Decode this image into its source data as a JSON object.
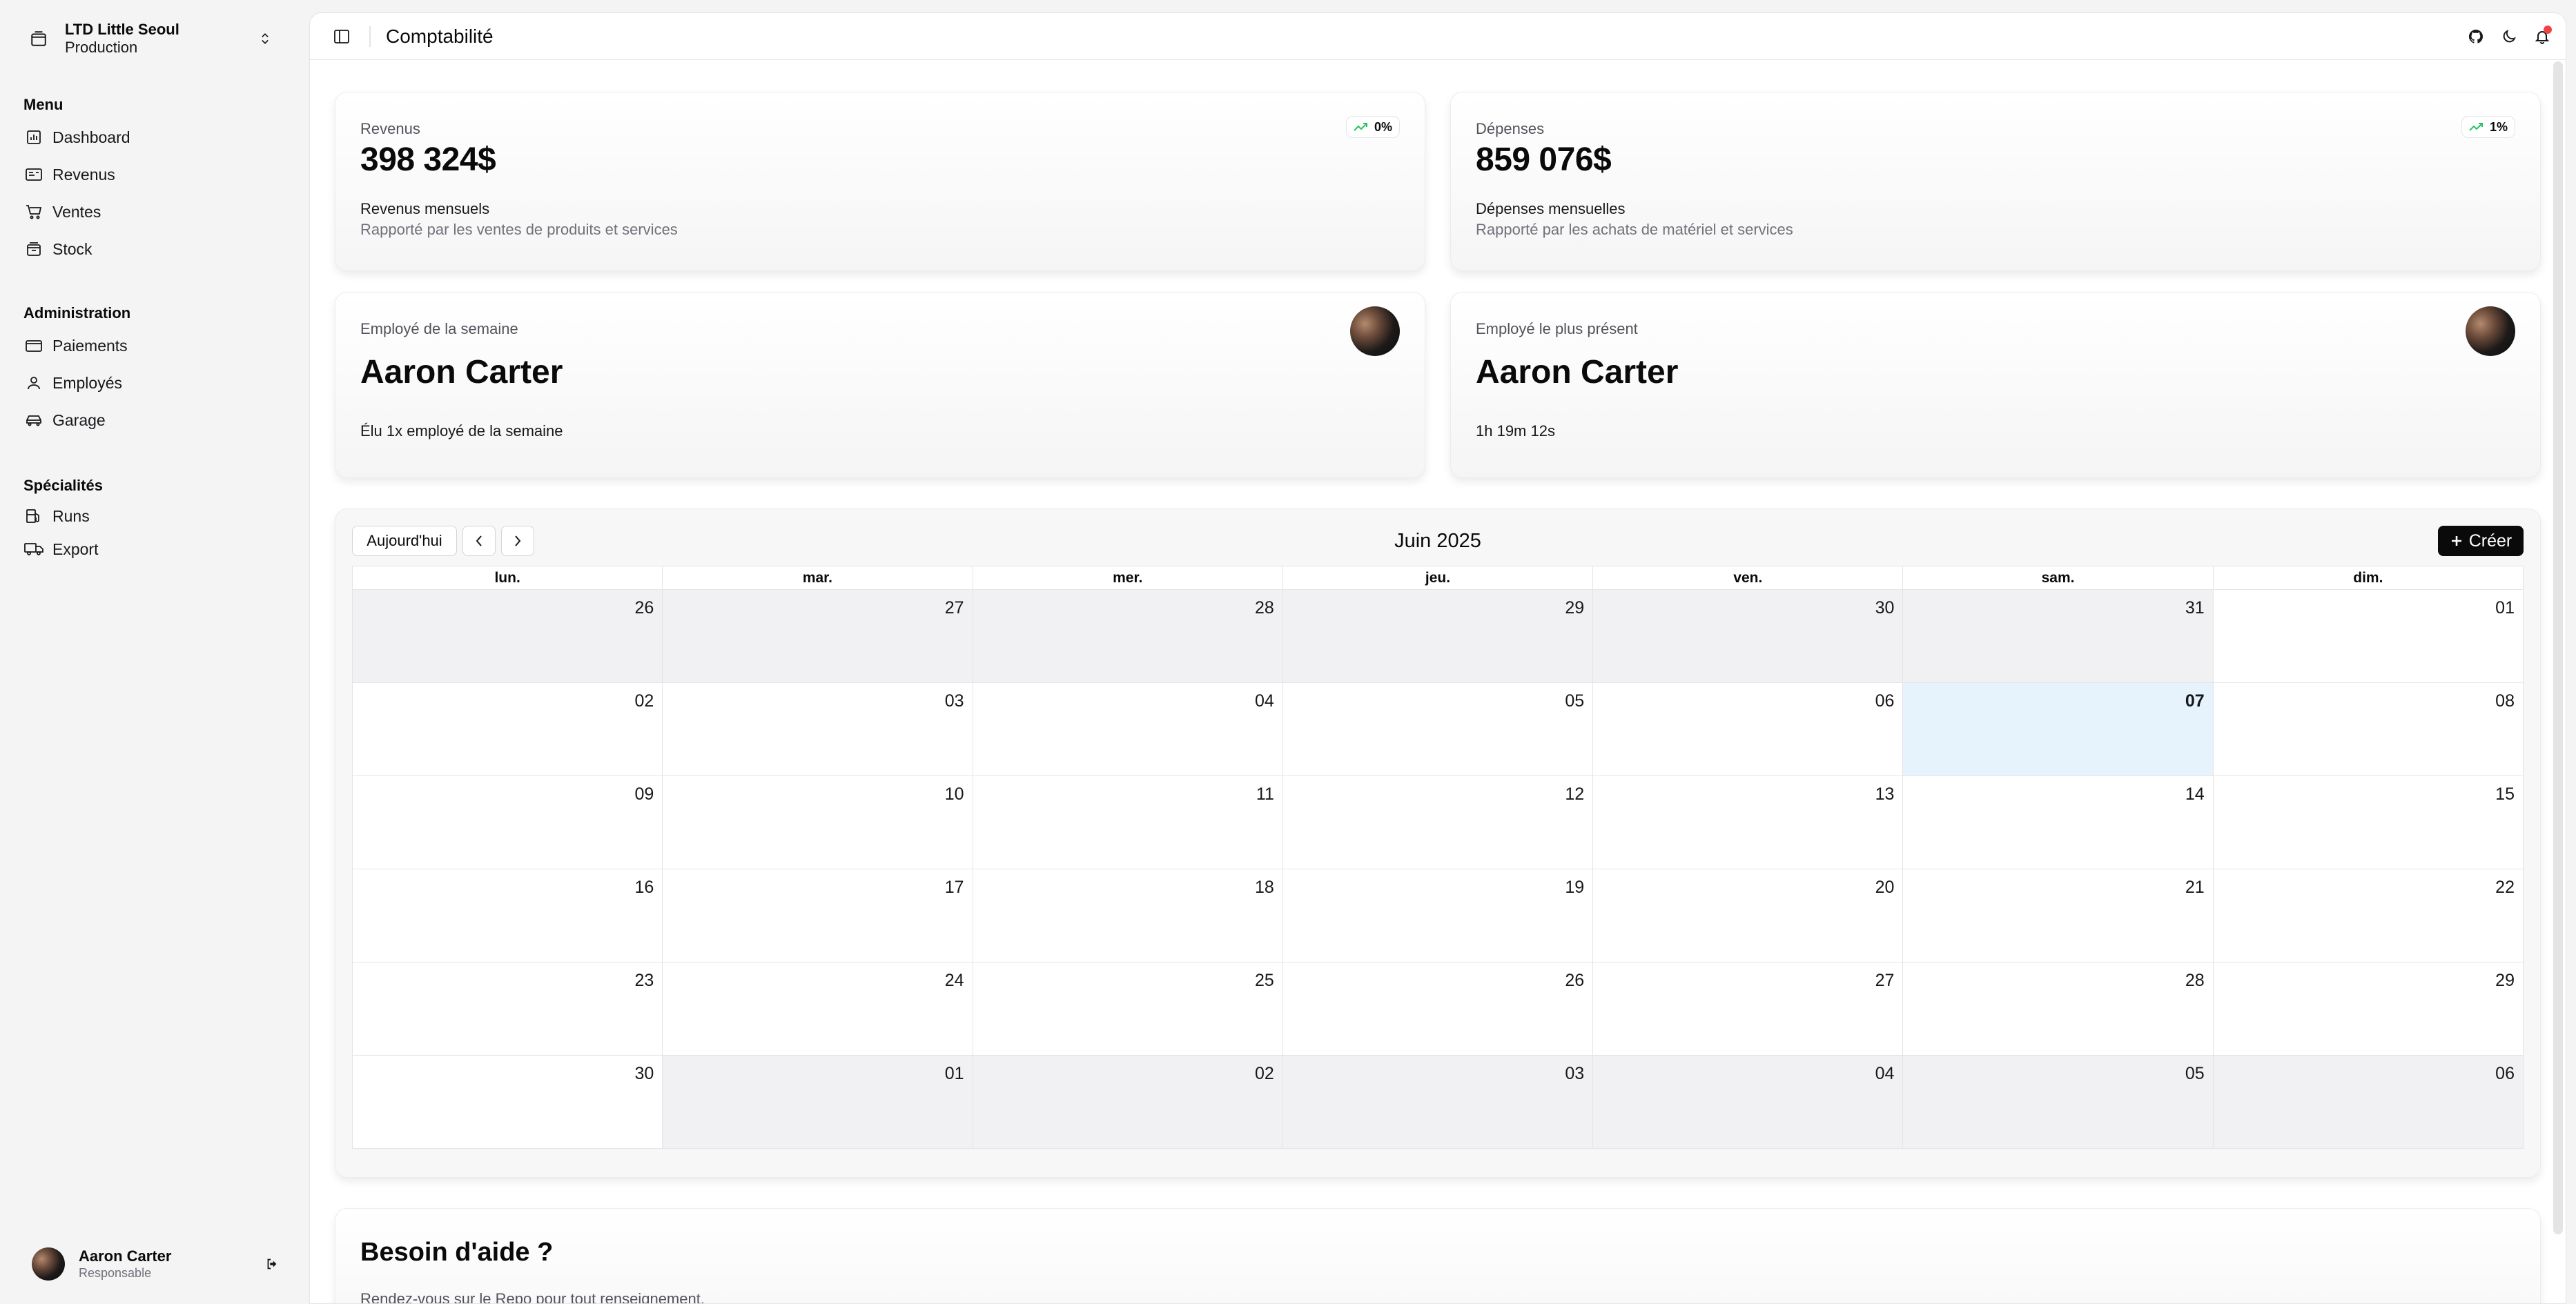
{
  "sidebar": {
    "org": {
      "name": "LTD Little Seoul",
      "env": "Production"
    },
    "groups": [
      {
        "title": "Menu",
        "items": [
          {
            "label": "Dashboard",
            "icon": "chart-icon"
          },
          {
            "label": "Revenus",
            "icon": "receipt-icon"
          },
          {
            "label": "Ventes",
            "icon": "cart-icon"
          },
          {
            "label": "Stock",
            "icon": "box-icon"
          }
        ]
      },
      {
        "title": "Administration",
        "items": [
          {
            "label": "Paiements",
            "icon": "wallet-icon"
          },
          {
            "label": "Employés",
            "icon": "user-icon"
          },
          {
            "label": "Garage",
            "icon": "car-icon"
          }
        ]
      },
      {
        "title": "Spécialités",
        "items": [
          {
            "label": "Runs",
            "icon": "fuel-icon"
          },
          {
            "label": "Export",
            "icon": "truck-icon"
          }
        ]
      }
    ],
    "user": {
      "name": "Aaron Carter",
      "role": "Responsable"
    }
  },
  "header": {
    "title": "Comptabilité"
  },
  "stats": [
    {
      "label": "Revenus",
      "value": "398 324$",
      "trend": "0%",
      "sub_title": "Revenus mensuels",
      "sub_text": "Rapporté par les ventes de produits et services"
    },
    {
      "label": "Dépenses",
      "value": "859 076$",
      "trend": "1%",
      "sub_title": "Dépenses mensuelles",
      "sub_text": "Rapporté par les achats de matériel et services"
    }
  ],
  "employees": [
    {
      "label": "Employé de la semaine",
      "name": "Aaron Carter",
      "note": "Élu 1x employé de la semaine"
    },
    {
      "label": "Employé le plus présent",
      "name": "Aaron Carter",
      "note": "1h 19m 12s"
    }
  ],
  "calendar": {
    "today_label": "Aujourd'hui",
    "title": "Juin 2025",
    "create_label": "Créer",
    "weekdays": [
      "lun.",
      "mar.",
      "mer.",
      "jeu.",
      "ven.",
      "sam.",
      "dim."
    ],
    "weeks": [
      [
        "26",
        "27",
        "28",
        "29",
        "30",
        "31",
        "01"
      ],
      [
        "02",
        "03",
        "04",
        "05",
        "06",
        "07",
        "08"
      ],
      [
        "09",
        "10",
        "11",
        "12",
        "13",
        "14",
        "15"
      ],
      [
        "16",
        "17",
        "18",
        "19",
        "20",
        "21",
        "22"
      ],
      [
        "23",
        "24",
        "25",
        "26",
        "27",
        "28",
        "29"
      ],
      [
        "30",
        "01",
        "02",
        "03",
        "04",
        "05",
        "06"
      ]
    ],
    "other_month": [
      [
        true,
        true,
        true,
        true,
        true,
        true,
        false
      ],
      [
        false,
        false,
        false,
        false,
        false,
        false,
        false
      ],
      [
        false,
        false,
        false,
        false,
        false,
        false,
        false
      ],
      [
        false,
        false,
        false,
        false,
        false,
        false,
        false
      ],
      [
        false,
        false,
        false,
        false,
        false,
        false,
        false
      ],
      [
        false,
        true,
        true,
        true,
        true,
        true,
        true
      ]
    ],
    "today": "07"
  },
  "help": {
    "title": "Besoin d'aide ?",
    "text": "Rendez-vous sur le Repo pour tout renseignement."
  },
  "colors": {
    "trend": "#22c55e",
    "today_bg": "#e6f3fd",
    "notif": "#ef4444"
  }
}
